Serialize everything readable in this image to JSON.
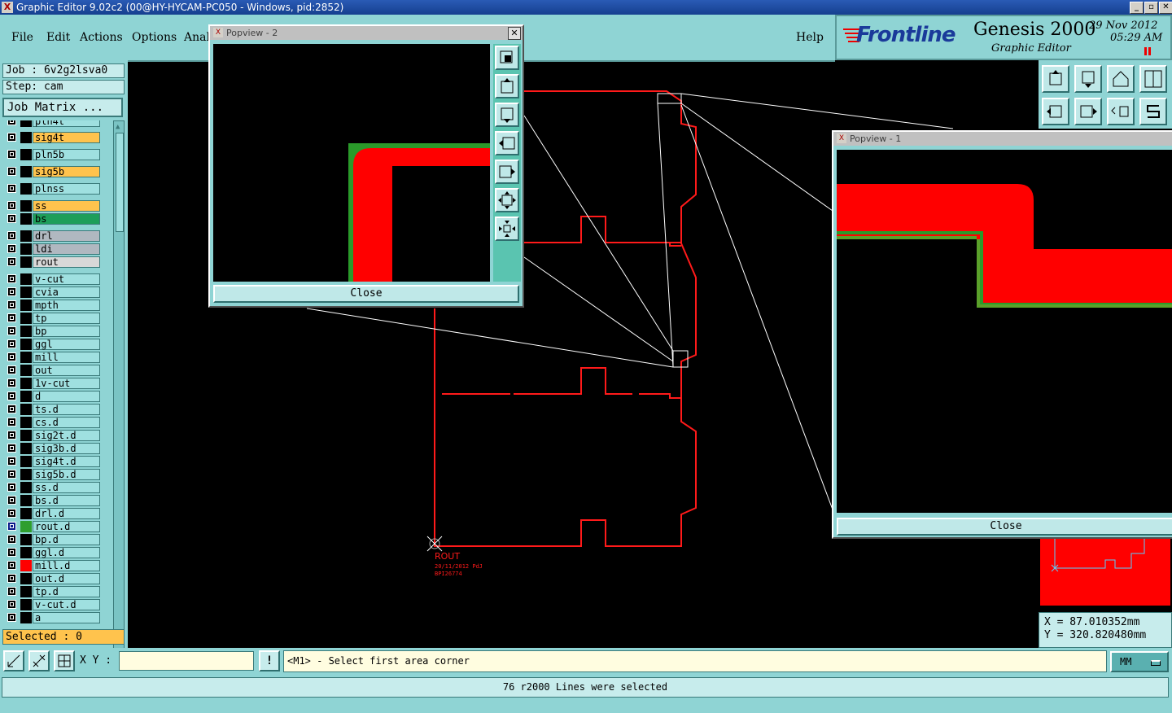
{
  "window": {
    "title": "Graphic Editor 9.02c2 (00@HY-HYCAM-PC050 - Windows, pid:2852)",
    "app_icon": "x-icon",
    "minimize": "_",
    "restore": "❐",
    "close": "✕"
  },
  "menu": {
    "file": "File",
    "edit": "Edit",
    "actions": "Actions",
    "options": "Options",
    "analysis": "Anal",
    "help": "Help"
  },
  "brand": {
    "logo": "Frontline",
    "product": "Genesis 2000",
    "subtitle": "Graphic Editor",
    "date": "29 Nov 2012",
    "time": "05:29 AM"
  },
  "left": {
    "job": "Job : 6v2g2lsva0",
    "step": "Step: cam",
    "job_matrix": "Job Matrix ...",
    "selected": "Selected : 0"
  },
  "layers": [
    {
      "name": "pln4t",
      "color": "#9fe0e0",
      "swatch": "#000"
    },
    {
      "name": "sig4t",
      "color": "#ffc34d",
      "swatch": "#000"
    },
    {
      "name": "pln5b",
      "color": "#9fe0e0",
      "swatch": "#000"
    },
    {
      "name": "sig5b",
      "color": "#ffc34d",
      "swatch": "#000"
    },
    {
      "name": "plnss",
      "color": "#9fe0e0",
      "swatch": "#000"
    },
    {
      "name": "ss",
      "color": "#ffc34d",
      "swatch": "#000"
    },
    {
      "name": "bs",
      "color": "#1e9e5a",
      "swatch": "#000"
    },
    {
      "name": "drl",
      "color": "#b0b8c0",
      "swatch": "#000"
    },
    {
      "name": "ldi",
      "color": "#b0b8c0",
      "swatch": "#000"
    },
    {
      "name": "rout",
      "color": "#d8d8d8",
      "swatch": "#000"
    },
    {
      "name": "v-cut",
      "color": "#9fe0e0",
      "swatch": "#000"
    },
    {
      "name": "cvia",
      "color": "#9fe0e0",
      "swatch": "#000"
    },
    {
      "name": "mpth",
      "color": "#9fe0e0",
      "swatch": "#000"
    },
    {
      "name": "tp",
      "color": "#9fe0e0",
      "swatch": "#000"
    },
    {
      "name": "bp",
      "color": "#9fe0e0",
      "swatch": "#000"
    },
    {
      "name": "ggl",
      "color": "#9fe0e0",
      "swatch": "#000"
    },
    {
      "name": "mill",
      "color": "#9fe0e0",
      "swatch": "#000"
    },
    {
      "name": "out",
      "color": "#9fe0e0",
      "swatch": "#000"
    },
    {
      "name": "1v-cut",
      "color": "#9fe0e0",
      "swatch": "#000"
    },
    {
      "name": "d",
      "color": "#9fe0e0",
      "swatch": "#000"
    },
    {
      "name": "ts.d",
      "color": "#9fe0e0",
      "swatch": "#000"
    },
    {
      "name": "cs.d",
      "color": "#9fe0e0",
      "swatch": "#000"
    },
    {
      "name": "sig2t.d",
      "color": "#9fe0e0",
      "swatch": "#000"
    },
    {
      "name": "sig3b.d",
      "color": "#9fe0e0",
      "swatch": "#000"
    },
    {
      "name": "sig4t.d",
      "color": "#9fe0e0",
      "swatch": "#000"
    },
    {
      "name": "sig5b.d",
      "color": "#9fe0e0",
      "swatch": "#000"
    },
    {
      "name": "ss.d",
      "color": "#9fe0e0",
      "swatch": "#000"
    },
    {
      "name": "bs.d",
      "color": "#9fe0e0",
      "swatch": "#000"
    },
    {
      "name": "drl.d",
      "color": "#9fe0e0",
      "swatch": "#000"
    },
    {
      "name": "rout.d",
      "color": "#9fe0e0",
      "swatch": "#2e9e2e",
      "active": true
    },
    {
      "name": "bp.d",
      "color": "#9fe0e0",
      "swatch": "#000"
    },
    {
      "name": "ggl.d",
      "color": "#9fe0e0",
      "swatch": "#000"
    },
    {
      "name": "mill.d",
      "color": "#9fe0e0",
      "swatch": "#ff0000"
    },
    {
      "name": "out.d",
      "color": "#9fe0e0",
      "swatch": "#000"
    },
    {
      "name": "tp.d",
      "color": "#9fe0e0",
      "swatch": "#000"
    },
    {
      "name": "v-cut.d",
      "color": "#9fe0e0",
      "swatch": "#000"
    },
    {
      "name": "a",
      "color": "#9fe0e0",
      "swatch": "#000"
    }
  ],
  "canvas": {
    "label_main": "ROUT",
    "label_date": "20/11/2012  PdJ",
    "label_code": "BPI26774"
  },
  "popview2": {
    "title": "Popview - 2",
    "close": "Close"
  },
  "popview1": {
    "title": "Popview - 1",
    "close": "Close"
  },
  "coords": {
    "x": "X = 87.010352mm",
    "y": "Y = 320.820480mm"
  },
  "bottom": {
    "xy_label": "X Y :",
    "xy_value": "",
    "prompt": "<M1> - Select first area corner",
    "units": "MM",
    "status": "76 r2000 Lines were selected",
    "info_icon": "!"
  }
}
